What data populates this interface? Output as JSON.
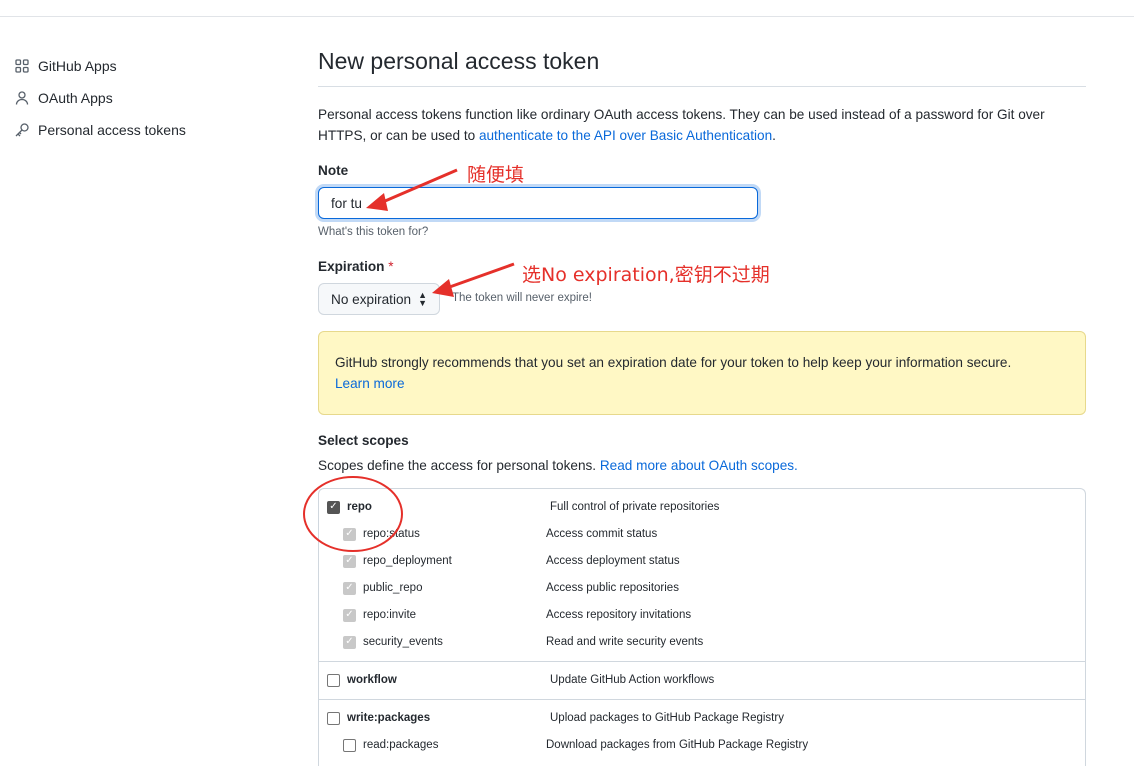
{
  "sidebar": {
    "items": [
      {
        "label": "GitHub Apps",
        "icon": "apps-grid-icon"
      },
      {
        "label": "OAuth Apps",
        "icon": "person-icon"
      },
      {
        "label": "Personal access tokens",
        "icon": "key-icon"
      }
    ]
  },
  "page": {
    "title": "New personal access token",
    "description_prefix": "Personal access tokens function like ordinary OAuth access tokens. They can be used instead of a password for Git over HTTPS, or can be used to ",
    "description_link": "authenticate to the API over Basic Authentication",
    "description_suffix": "."
  },
  "note": {
    "label": "Note",
    "value": "for tu",
    "hint": "What's this token for?"
  },
  "expiration": {
    "label": "Expiration",
    "required_mark": "*",
    "selected": "No expiration",
    "hint": "The token will never expire!"
  },
  "warning": {
    "text": "GitHub strongly recommends that you set an expiration date for your token to help keep your information secure.",
    "link": "Learn more"
  },
  "scopes": {
    "label": "Select scopes",
    "description": "Scopes define the access for personal tokens. ",
    "link": "Read more about OAuth scopes.",
    "items": [
      {
        "name": "repo",
        "desc": "Full control of private repositories",
        "state": "checked",
        "level": "parent"
      },
      {
        "name": "repo:status",
        "desc": "Access commit status",
        "state": "disabled-checked",
        "level": "child"
      },
      {
        "name": "repo_deployment",
        "desc": "Access deployment status",
        "state": "disabled-checked",
        "level": "child"
      },
      {
        "name": "public_repo",
        "desc": "Access public repositories",
        "state": "disabled-checked",
        "level": "child"
      },
      {
        "name": "repo:invite",
        "desc": "Access repository invitations",
        "state": "disabled-checked",
        "level": "child"
      },
      {
        "name": "security_events",
        "desc": "Read and write security events",
        "state": "disabled-checked",
        "level": "child"
      },
      {
        "name": "workflow",
        "desc": "Update GitHub Action workflows",
        "state": "unchecked",
        "level": "parent"
      },
      {
        "name": "write:packages",
        "desc": "Upload packages to GitHub Package Registry",
        "state": "unchecked",
        "level": "parent"
      },
      {
        "name": "read:packages",
        "desc": "Download packages from GitHub Package Registry",
        "state": "unchecked",
        "level": "child"
      }
    ]
  },
  "annotations": {
    "note_tip": "随便填",
    "expiration_tip": "选No expiration,密钥不过期",
    "color": "#e5302a"
  },
  "colors": {
    "link": "#0969da",
    "warning_bg": "#fff8c5",
    "required": "#cf222e"
  }
}
